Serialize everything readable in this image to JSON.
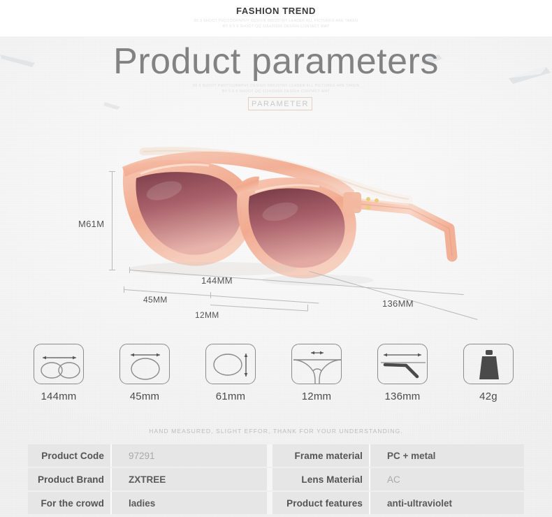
{
  "header": {
    "title": "FASHION TREND",
    "subtext": "95 9 SHOOT PHOTOGRAPHY DESIGN INDUSTRY LEADER ALL PICTURES ARE TAKEN\nBY 9 5 9 SHOOT QQ:115430666 DESIGN CONTACT WAY"
  },
  "hero": {
    "title": "Product parameters",
    "subtext": "95 9 SHOOT PHOTOGRAPHY DESIGN INDUSTRY LEADER ALL PICTURES ARE TAKEN\nBY 9 5 9 SHOOT QQ:115430666 DESIGN CONTACT WAY",
    "badge": "PARAMETER"
  },
  "dimensions": {
    "height_label": "M61M",
    "width_label": "144MM",
    "lens_label": "45MM",
    "bridge_label": "12MM",
    "temple_label": "136MM"
  },
  "spec_icons": [
    {
      "caption": "144mm",
      "icon": "frame-width-icon"
    },
    {
      "caption": "45mm",
      "icon": "lens-width-icon"
    },
    {
      "caption": "61mm",
      "icon": "lens-height-icon"
    },
    {
      "caption": "12mm",
      "icon": "bridge-width-icon"
    },
    {
      "caption": "136mm",
      "icon": "temple-length-icon"
    },
    {
      "caption": "42g",
      "icon": "weight-icon"
    }
  ],
  "disclaimer": "HAND MEASURED, SLIGHT EFFOR, THANK FOR YOUR UNDERSTANDING.",
  "spec_table": {
    "rows": [
      {
        "left_key": "Product Code",
        "left_value": "97291",
        "left_style": "light",
        "right_key": "Frame material",
        "right_value": "PC + metal",
        "right_style": "bold"
      },
      {
        "left_key": "Product Brand",
        "left_value": "ZXTREE",
        "left_style": "bold",
        "right_key": "Lens Material",
        "right_value": "AC",
        "right_style": "light"
      },
      {
        "left_key": "For the crowd",
        "left_value": "ladies",
        "left_style": "bold",
        "right_key": "Product features",
        "right_value": "anti-ultraviolet",
        "right_style": "bold"
      }
    ]
  },
  "colors": {
    "page_background": "#f6f6f6",
    "header_background": "#ffffff",
    "title_text": "#828282",
    "badge_border": "#e6cfc2",
    "table_row": "#e6e6e6",
    "frame_pink": "#f0ab8f",
    "lens_brown": "#8a4a52",
    "icon_stroke": "#8c8c8c",
    "dimension_line": "#b9b9b9"
  }
}
